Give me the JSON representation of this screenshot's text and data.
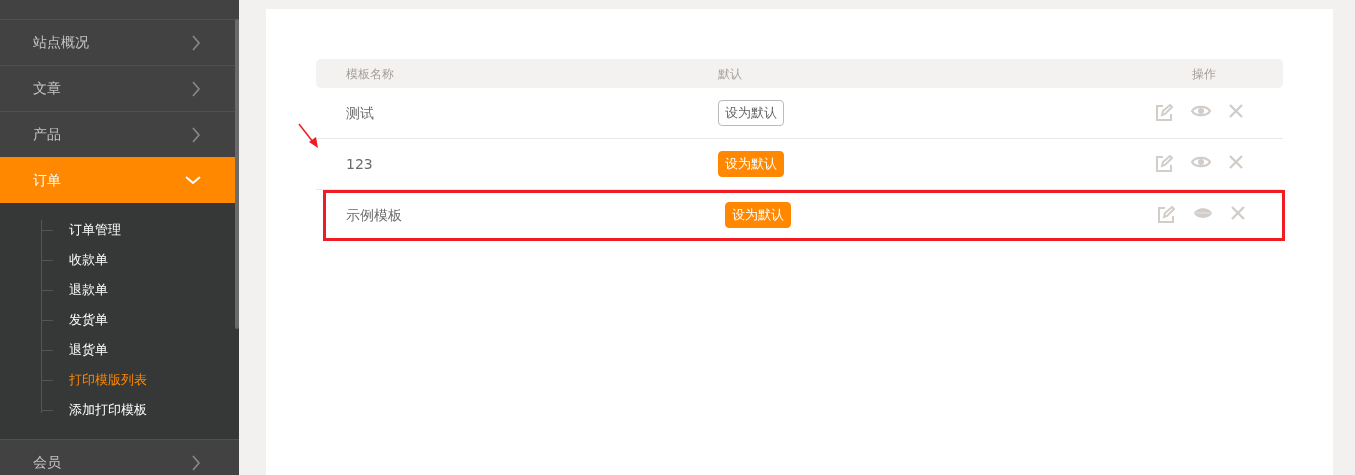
{
  "sidebar": {
    "items": [
      {
        "label": "站点概况",
        "selected": false,
        "expanded": false
      },
      {
        "label": "文章",
        "selected": false,
        "expanded": false
      },
      {
        "label": "产品",
        "selected": false,
        "expanded": false
      },
      {
        "label": "订单",
        "selected": true,
        "expanded": true,
        "children": [
          {
            "label": "订单管理",
            "selected": false
          },
          {
            "label": "收款单",
            "selected": false
          },
          {
            "label": "退款单",
            "selected": false
          },
          {
            "label": "发货单",
            "selected": false
          },
          {
            "label": "退货单",
            "selected": false
          },
          {
            "label": "打印模版列表",
            "selected": true
          },
          {
            "label": "添加打印模板",
            "selected": false
          }
        ]
      },
      {
        "label": "会员",
        "selected": false,
        "expanded": false
      }
    ]
  },
  "table": {
    "columns": [
      "模板名称",
      "默认",
      "操作"
    ],
    "rows": [
      {
        "name": "测试",
        "button": "设为默认",
        "is_default": true,
        "preview_hidden": false,
        "highlighted": false,
        "arrow": false
      },
      {
        "name": "123",
        "button": "设为默认",
        "is_default": false,
        "preview_hidden": false,
        "highlighted": false,
        "arrow": true
      },
      {
        "name": "示例模板",
        "button": "设为默认",
        "is_default": false,
        "preview_hidden": true,
        "highlighted": true,
        "arrow": false
      }
    ]
  }
}
